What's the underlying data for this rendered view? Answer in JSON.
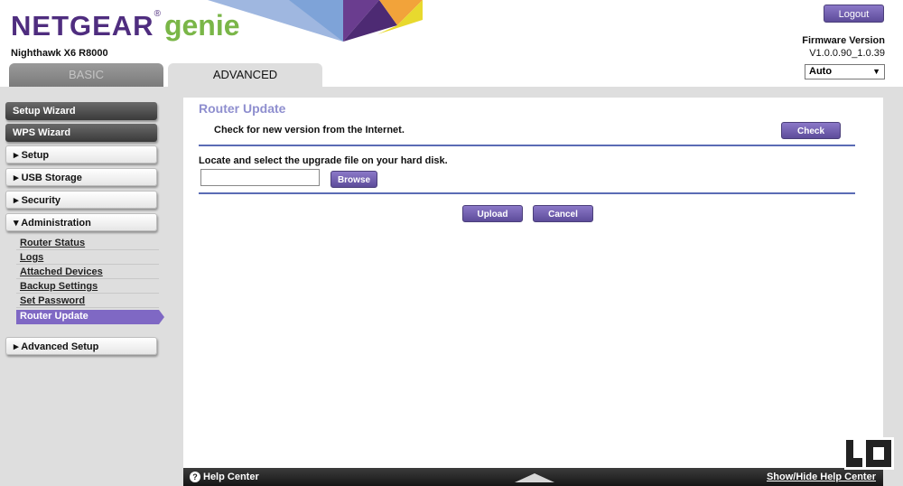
{
  "header": {
    "brand_main": "NETGEAR",
    "brand_reg": "®",
    "brand_sub": "genie",
    "model": "Nighthawk X6 R8000",
    "logout_label": "Logout",
    "firmware_label": "Firmware Version",
    "firmware_value": "V1.0.0.90_1.0.39",
    "language_selected": "Auto",
    "tabs": [
      {
        "label": "BASIC",
        "active": false
      },
      {
        "label": "ADVANCED",
        "active": true
      }
    ]
  },
  "sidebar": {
    "top_buttons": [
      {
        "label": "Setup Wizard"
      },
      {
        "label": "WPS Wizard"
      }
    ],
    "sections": [
      {
        "label": "Setup",
        "expanded": false
      },
      {
        "label": "USB Storage",
        "expanded": false
      },
      {
        "label": "Security",
        "expanded": false
      },
      {
        "label": "Administration",
        "expanded": true
      },
      {
        "label": "Advanced Setup",
        "expanded": false
      }
    ],
    "admin_items": [
      {
        "label": "Router Status"
      },
      {
        "label": "Logs"
      },
      {
        "label": "Attached Devices"
      },
      {
        "label": "Backup Settings"
      },
      {
        "label": "Set Password"
      },
      {
        "label": "Router Update",
        "active": true
      }
    ],
    "collapsed_icon": "triangle-right-icon",
    "expanded_icon": "triangle-down-icon"
  },
  "main": {
    "title": "Router Update",
    "check_text": "Check for new version from the Internet.",
    "check_button": "Check",
    "upload_text": "Locate and select the upgrade file on your hard disk.",
    "file_value": "",
    "browse_button": "Browse",
    "upload_button": "Upload",
    "cancel_button": "Cancel"
  },
  "footer": {
    "help_label": "Help Center",
    "help_toggle": "Show/Hide Help Center"
  },
  "colors": {
    "accent": "#7f68c4",
    "brand_purple": "#4f2d7f",
    "brand_green": "#7ab648",
    "divider": "#5a6bb5",
    "title": "#8f8fcf"
  }
}
